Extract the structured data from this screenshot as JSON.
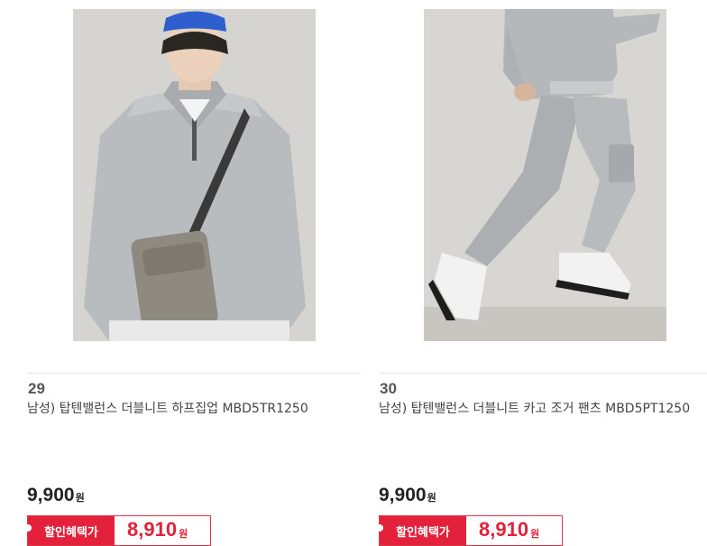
{
  "products": [
    {
      "rank": "29",
      "name": "남성) 탑텐밸런스 더블니트 하프집업 MBD5TR1250",
      "price": "9,900",
      "currency": "원",
      "benefit_label": "할인혜택가",
      "benefit_price": "8,910",
      "image_icon": "model-half-zip-photo"
    },
    {
      "rank": "30",
      "name": "남성) 탑텐밸런스 더블니트 카고 조거 팬츠 MBD5PT1250",
      "price": "9,900",
      "currency": "원",
      "benefit_label": "할인혜택가",
      "benefit_price": "8,910",
      "image_icon": "model-jogger-pants-photo"
    }
  ],
  "colors": {
    "accent": "#e3213a",
    "text": "#222222",
    "photo_bg": "#d5d3d0"
  }
}
